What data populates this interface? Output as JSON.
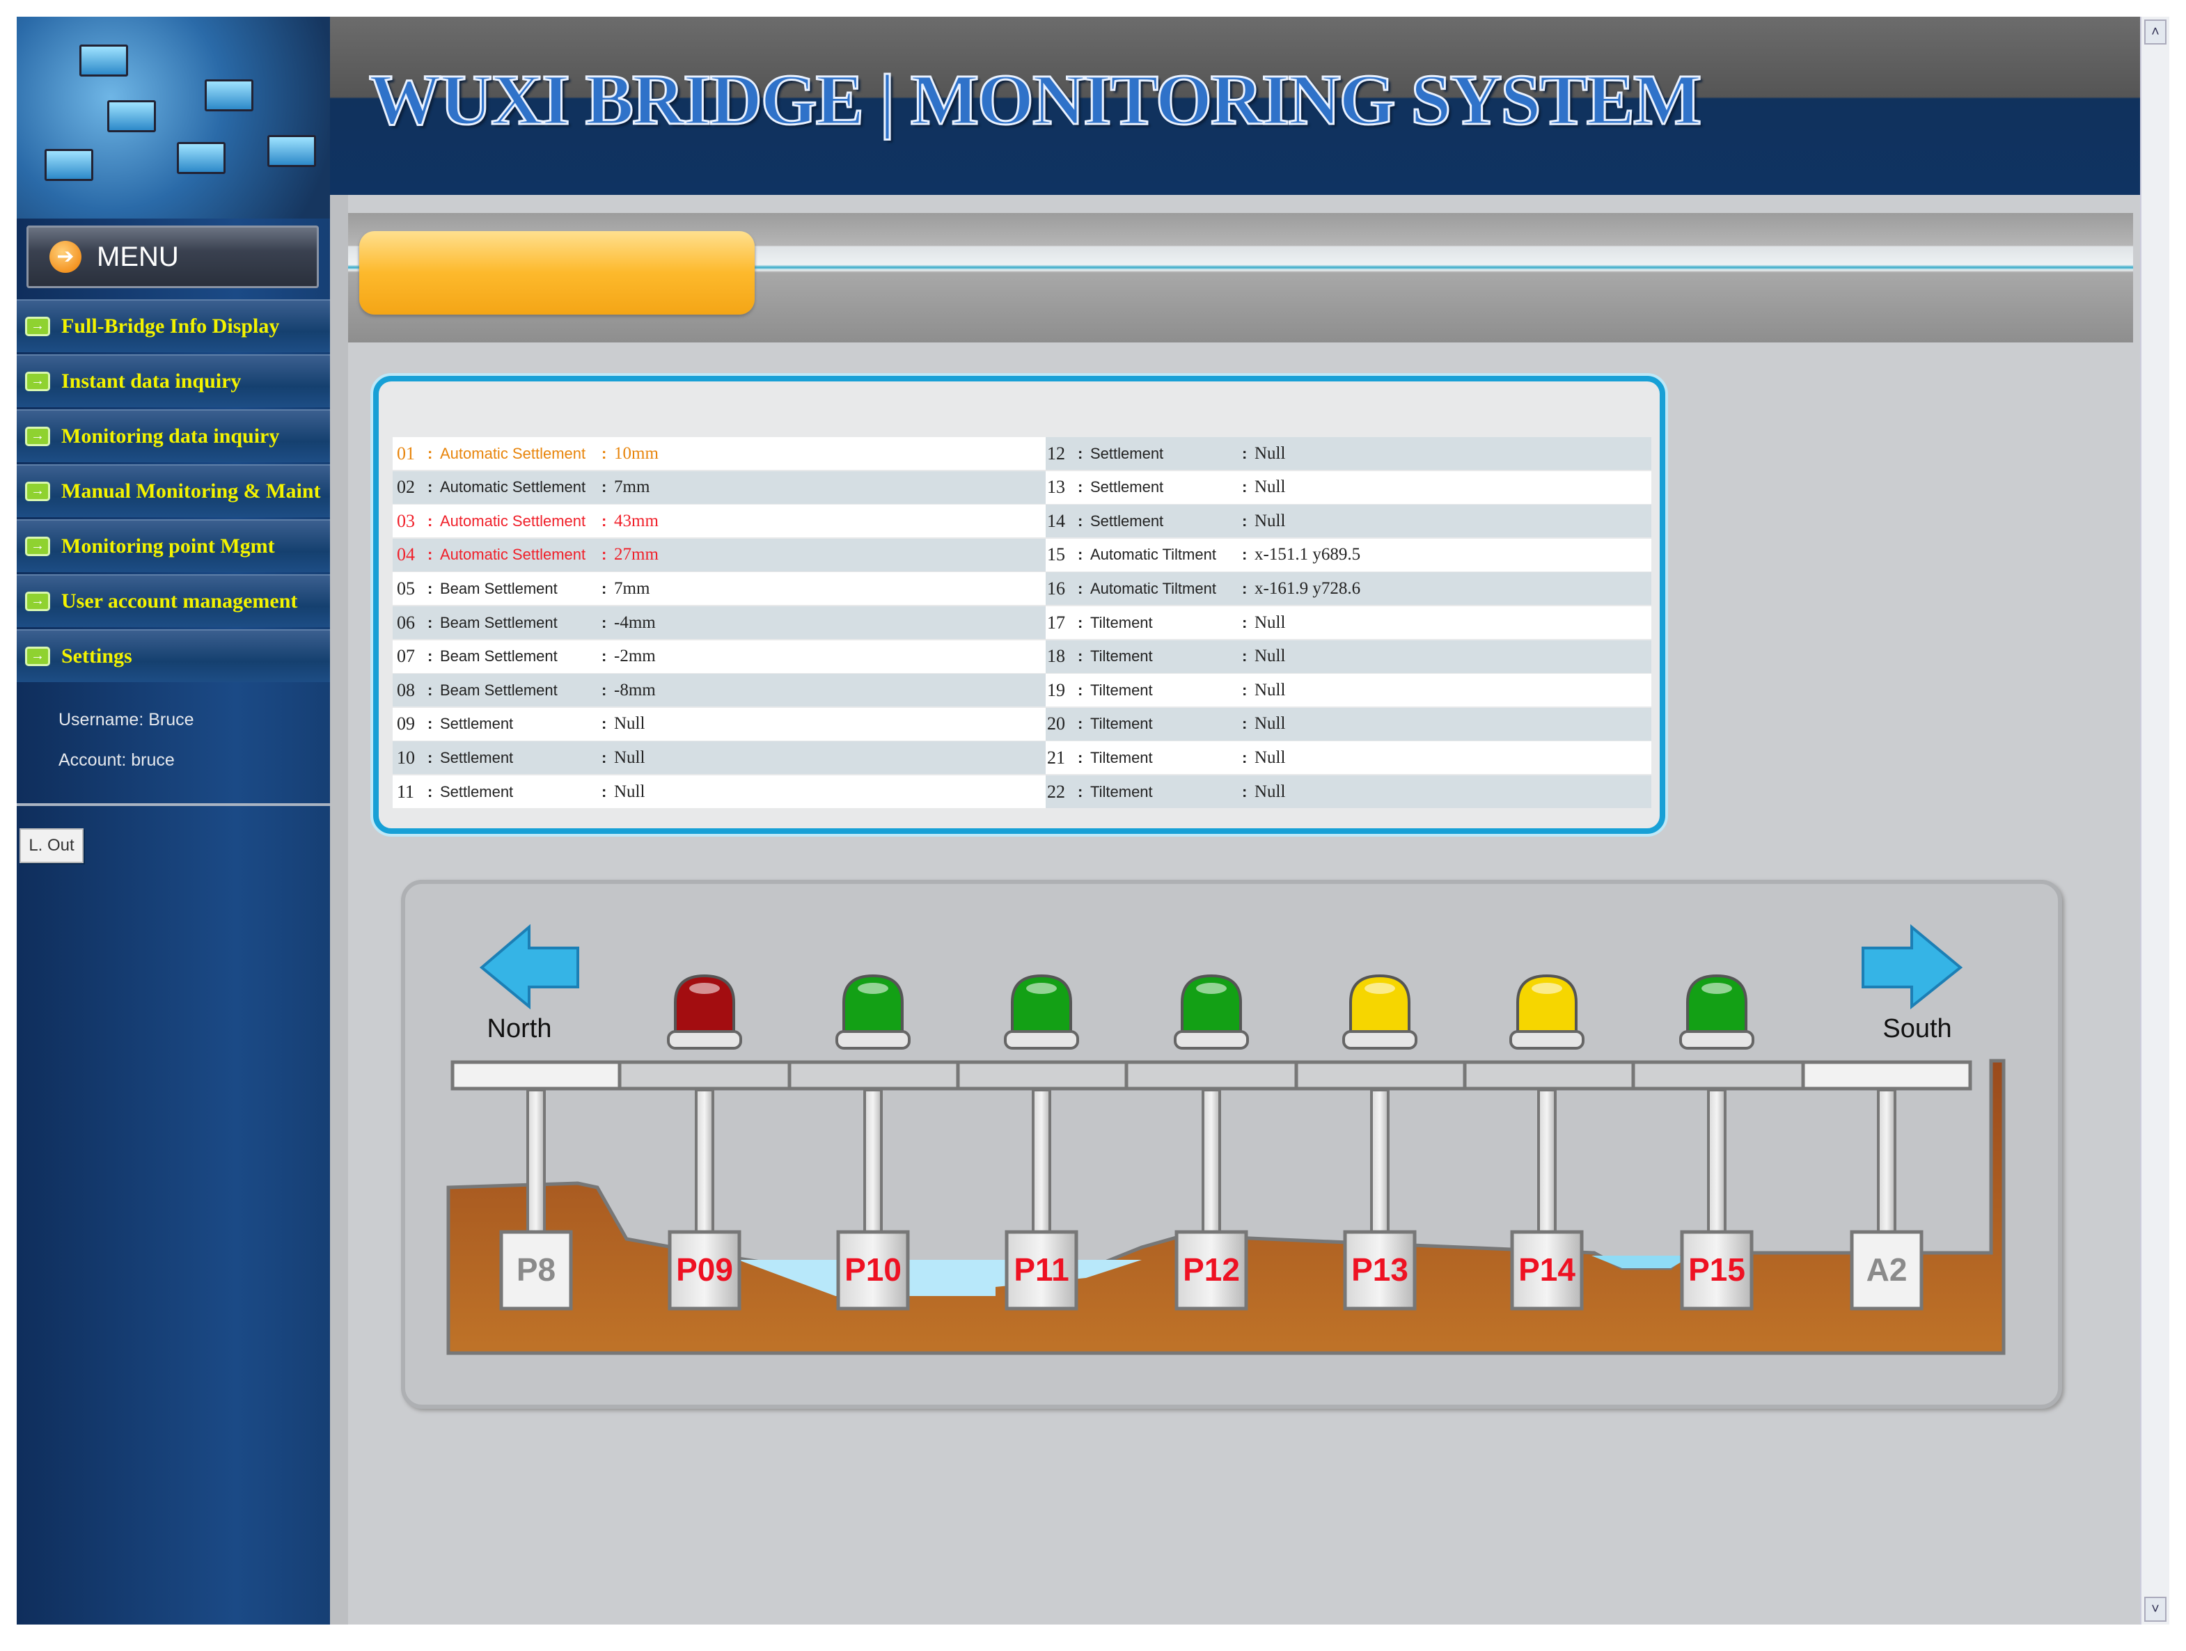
{
  "header": {
    "title": "WUXI BRIDGE | MONITORING SYSTEM"
  },
  "sidebar": {
    "menu_label": "MENU",
    "items": [
      {
        "label": "Full-Bridge Info Display"
      },
      {
        "label": "Instant data inquiry"
      },
      {
        "label": "Monitoring data inquiry"
      },
      {
        "label": "Manual Monitoring & Maint"
      },
      {
        "label": "Monitoring point Mgmt"
      },
      {
        "label": "User account management"
      },
      {
        "label": "Settings"
      }
    ],
    "username": "Username: Bruce",
    "account": "Account: bruce",
    "logout_label": "L. Out"
  },
  "colors": {
    "orange": "#e8850c",
    "red": "#f0202a",
    "normal": "#222222",
    "light_red": "#a30d10",
    "light_green": "#13a015",
    "light_yellow": "#f6d600",
    "pier_label_red": "#ee1122",
    "pier_label_gray": "#8a8a8a"
  },
  "table": {
    "left": [
      {
        "no": "01",
        "label": "Automatic Settlement",
        "value": "10mm",
        "status": "orange"
      },
      {
        "no": "02",
        "label": "Automatic Settlement",
        "value": "7mm",
        "status": "normal"
      },
      {
        "no": "03",
        "label": "Automatic Settlement",
        "value": "43mm",
        "status": "red"
      },
      {
        "no": "04",
        "label": "Automatic Settlement",
        "value": "27mm",
        "status": "red"
      },
      {
        "no": "05",
        "label": "Beam Settlement",
        "value": "7mm",
        "status": "normal"
      },
      {
        "no": "06",
        "label": "Beam Settlement",
        "value": "-4mm",
        "status": "normal"
      },
      {
        "no": "07",
        "label": "Beam Settlement",
        "value": "-2mm",
        "status": "normal"
      },
      {
        "no": "08",
        "label": "Beam Settlement",
        "value": "-8mm",
        "status": "normal"
      },
      {
        "no": "09",
        "label": "Settlement",
        "value": "Null",
        "status": "normal"
      },
      {
        "no": "10",
        "label": "Settlement",
        "value": "Null",
        "status": "normal"
      },
      {
        "no": "11",
        "label": "Settlement",
        "value": "Null",
        "status": "normal"
      }
    ],
    "right": [
      {
        "no": "12",
        "label": "Settlement",
        "value": "Null",
        "status": "normal"
      },
      {
        "no": "13",
        "label": "Settlement",
        "value": "Null",
        "status": "normal"
      },
      {
        "no": "14",
        "label": "Settlement",
        "value": "Null",
        "status": "normal"
      },
      {
        "no": "15",
        "label": "Automatic Tiltment",
        "value": "x-151.1 y689.5",
        "status": "normal"
      },
      {
        "no": "16",
        "label": "Automatic Tiltment",
        "value": "x-161.9 y728.6",
        "status": "normal"
      },
      {
        "no": "17",
        "label": "Tiltement",
        "value": "Null",
        "status": "normal"
      },
      {
        "no": "18",
        "label": "Tiltement",
        "value": "Null",
        "status": "normal"
      },
      {
        "no": "19",
        "label": "Tiltement",
        "value": "Null",
        "status": "normal"
      },
      {
        "no": "20",
        "label": "Tiltement",
        "value": "Null",
        "status": "normal"
      },
      {
        "no": "21",
        "label": "Tiltement",
        "value": "Null",
        "status": "normal"
      },
      {
        "no": "22",
        "label": "Tiltement",
        "value": "Null",
        "status": "normal"
      }
    ]
  },
  "bridge": {
    "north_label": "North",
    "south_label": "South",
    "piers": [
      {
        "label": "P8",
        "light": null,
        "alert": false
      },
      {
        "label": "P09",
        "light": "red",
        "alert": true
      },
      {
        "label": "P10",
        "light": "green",
        "alert": true
      },
      {
        "label": "P11",
        "light": "green",
        "alert": true
      },
      {
        "label": "P12",
        "light": "green",
        "alert": true
      },
      {
        "label": "P13",
        "light": "yellow",
        "alert": true
      },
      {
        "label": "P14",
        "light": "yellow",
        "alert": true
      },
      {
        "label": "P15",
        "light": "green",
        "alert": true
      },
      {
        "label": "A2",
        "light": null,
        "alert": false
      }
    ]
  }
}
